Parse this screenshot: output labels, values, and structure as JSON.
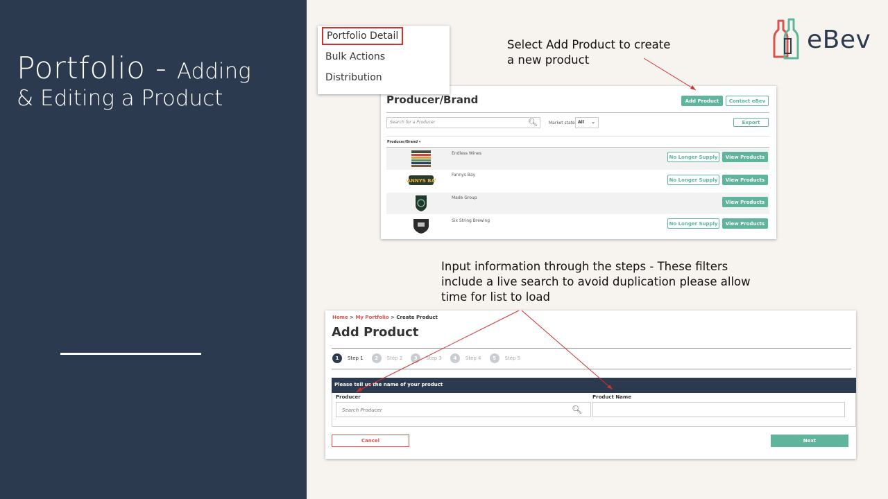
{
  "slide": {
    "title_big": "Portfolio - ",
    "title_small": "Adding",
    "title_line2": "& Editing a Product"
  },
  "logo": {
    "text": "eBev"
  },
  "annotations": {
    "note1": "Select Add Product to create a new product",
    "note2": "Input information through the steps - These filters include a live search to avoid duplication please allow time for list to load"
  },
  "menu": {
    "items": [
      "Portfolio Detail",
      "Bulk Actions",
      "Distribution"
    ],
    "active_index": 0
  },
  "producer_brand": {
    "title": "Producer/Brand",
    "add_product": "Add Product",
    "contact": "Contact eBev",
    "search_placeholder": "Search for a Producer",
    "market_label": "Market state",
    "market_value": "All",
    "export": "Export",
    "column_header": "Producer/Brand",
    "no_longer_supply": "No Longer Supply",
    "view_products": "View Products",
    "rows": [
      {
        "name": "Endless Wines"
      },
      {
        "name": "Fannys Bay"
      },
      {
        "name": "Made Group"
      },
      {
        "name": "Six String Brewing"
      }
    ],
    "logo_text": "FANNYS BAY"
  },
  "add_product": {
    "breadcrumb": [
      "Home",
      "My Portfolio",
      "Create Product"
    ],
    "title": "Add Product",
    "steps": [
      "Step 1",
      "Step 2",
      "Step 3",
      "Step 4",
      "Step 5"
    ],
    "step_numbers": [
      "1",
      "2",
      "3",
      "4",
      "5"
    ],
    "section_title": "Please tell us the name of your product",
    "producer_label": "Producer",
    "producer_placeholder": "Search Producer",
    "product_name_label": "Product Name",
    "product_name_value": "",
    "cancel": "Cancel",
    "next": "Next"
  },
  "colors": {
    "navy": "#2c3a50",
    "green": "#5fb49c",
    "red": "#d32f2f",
    "background": "#f7f3ef"
  },
  "icons": {
    "search": "search-icon",
    "chevron": "chevron-down-icon",
    "sort": "sort-down-icon"
  }
}
